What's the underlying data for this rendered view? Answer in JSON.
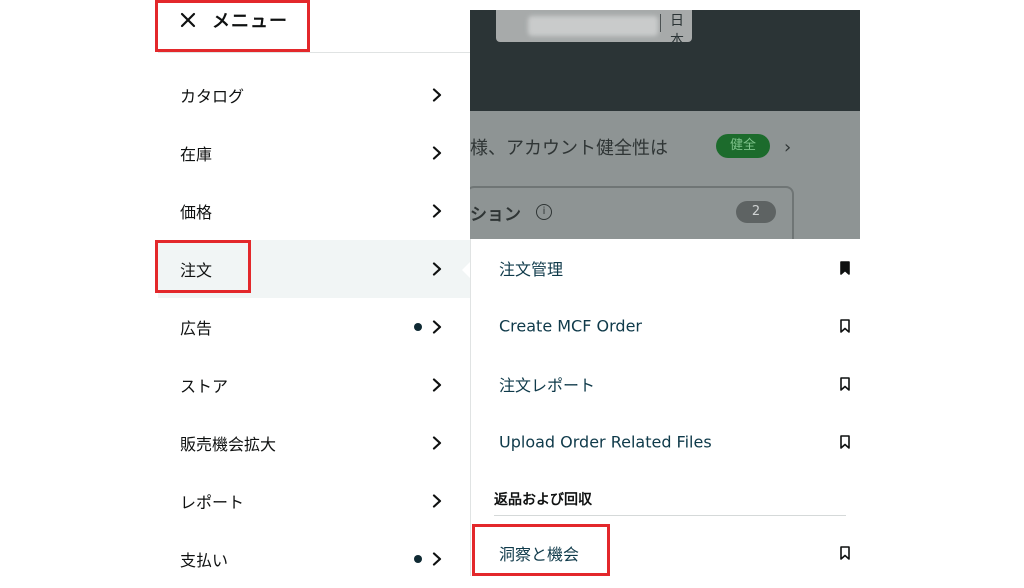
{
  "menu": {
    "title": "メニュー",
    "close_icon": "close-icon",
    "items": [
      {
        "label": "カタログ",
        "dot": false,
        "active": false
      },
      {
        "label": "在庫",
        "dot": false,
        "active": false
      },
      {
        "label": "価格",
        "dot": false,
        "active": false
      },
      {
        "label": "注文",
        "dot": false,
        "active": true
      },
      {
        "label": "広告",
        "dot": true,
        "active": false
      },
      {
        "label": "ストア",
        "dot": false,
        "active": false
      },
      {
        "label": "販売機会拡大",
        "dot": false,
        "active": false
      },
      {
        "label": "レポート",
        "dot": false,
        "active": false
      },
      {
        "label": "支払い",
        "dot": true,
        "active": false
      }
    ]
  },
  "submenu": {
    "items": [
      {
        "label": "注文管理",
        "bookmarked": true
      },
      {
        "label": "Create MCF Order",
        "bookmarked": false
      },
      {
        "label": "注文レポート",
        "bookmarked": false
      },
      {
        "label": "Upload Order Related Files",
        "bookmarked": false
      }
    ],
    "section_header": "返品および回収",
    "section_items": [
      {
        "label": "洞察と機会",
        "bookmarked": false
      }
    ]
  },
  "background": {
    "region": "日本",
    "health_text": "様、アカウント健全性は",
    "health_badge": "健全",
    "card_title": "ション",
    "card_count": "2"
  },
  "colors": {
    "highlight_box": "#e3282b",
    "active_bg": "#f1f5f5",
    "dimmed_header": "#2b3436",
    "dimmed_body": "#8e9494"
  }
}
